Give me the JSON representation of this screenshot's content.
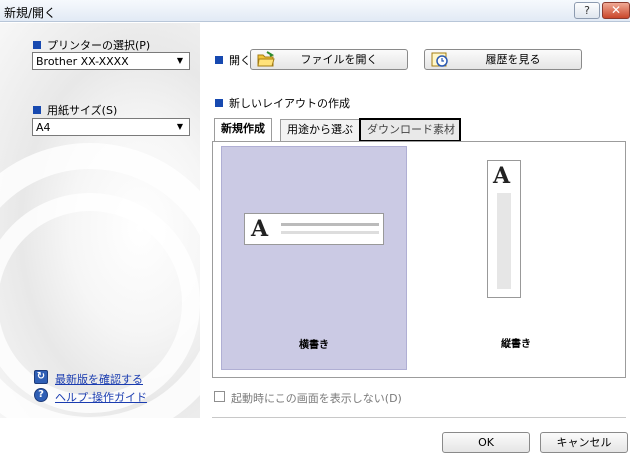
{
  "window": {
    "title": "新規/開く",
    "help_label": "?",
    "close_label": "✕"
  },
  "printer": {
    "label": "プリンターの選択(P)",
    "value": "Brother XX-XXXX"
  },
  "paper": {
    "label": "用紙サイズ(S)",
    "value": "A4"
  },
  "open": {
    "label": "開く",
    "open_file": "ファイルを開く",
    "history": "履歴を見る"
  },
  "new_layout": {
    "label": "新しいレイアウトの作成",
    "tabs": [
      "新規作成",
      "用途から選ぶ",
      "ダウンロード素材"
    ],
    "cards": [
      {
        "label": "横書き",
        "glyph": "A"
      },
      {
        "label": "縦書き",
        "glyph": "A"
      }
    ]
  },
  "links": {
    "update": "最新版を確認する",
    "help": "ヘルプ-操作ガイド"
  },
  "startup_checkbox": "起動時にこの画面を表示しない(D)",
  "buttons": {
    "ok": "OK",
    "cancel": "キャンセル"
  },
  "colors": {
    "accent": "#1749b0",
    "selected_card": "#cbcae4",
    "link": "#1a3cb0"
  },
  "icons": [
    "folder-open-icon",
    "history-icon",
    "update-icon",
    "help-icon"
  ]
}
